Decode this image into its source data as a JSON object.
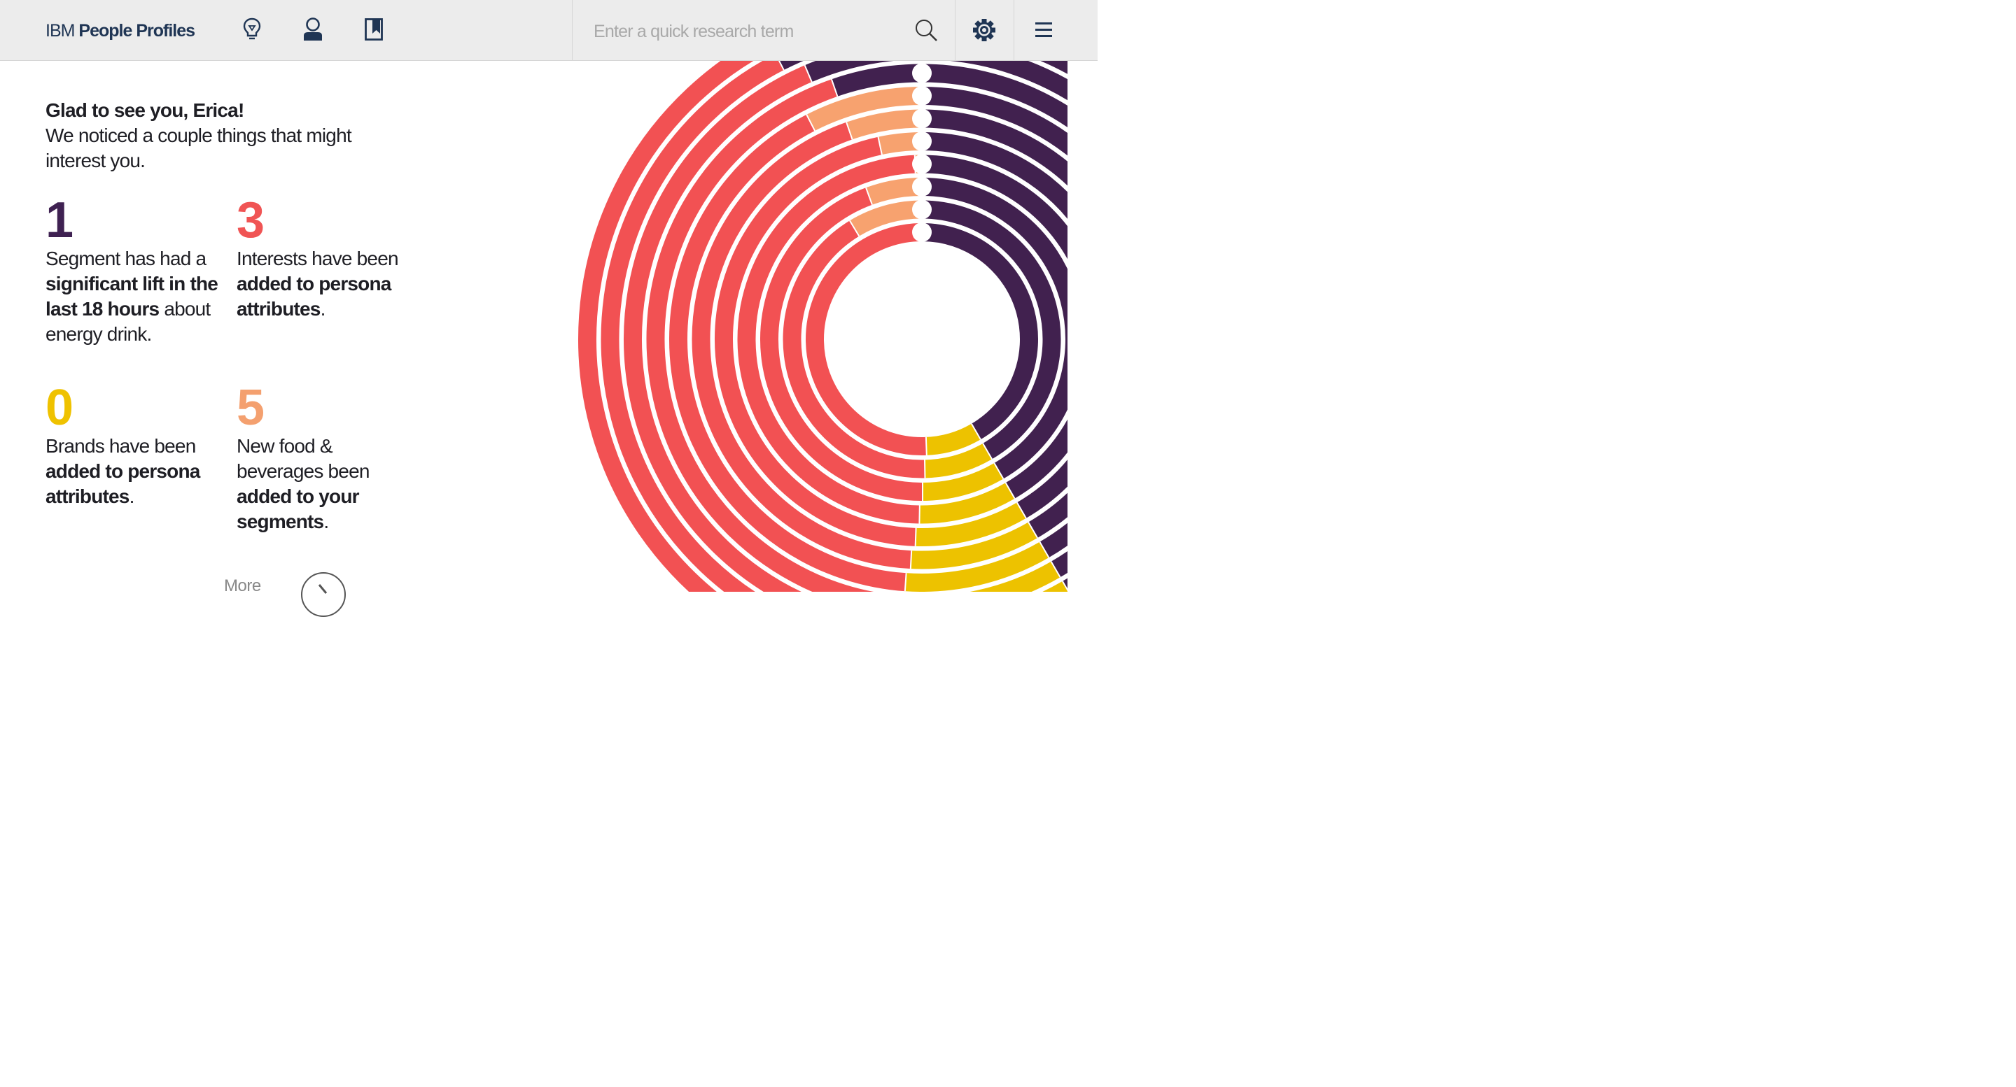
{
  "header": {
    "brand_light": "IBM",
    "brand_bold": "People Profiles",
    "nav_icons": [
      "lightbulb-icon",
      "person-icon",
      "bookmark-icon"
    ],
    "search_placeholder": "Enter a quick research term",
    "search_icon": "search-icon",
    "settings_icon": "gear-icon",
    "menu_icon": "hamburger-menu-icon"
  },
  "greeting": {
    "hello": "Glad to see you, Erica!",
    "subtitle": "We noticed a couple things that might interest you."
  },
  "stats": [
    {
      "number": "1",
      "color": "#3f2152",
      "pre": "Segment has had a ",
      "bold": "significant lift in the last 18 hours",
      "post": " about energy drink."
    },
    {
      "number": "3",
      "color": "#f05454",
      "pre": "Interests have been ",
      "bold": "added to persona attributes",
      "post": "."
    },
    {
      "number": "0",
      "color": "#efc200",
      "pre": "Brands have been ",
      "bold": "added to persona attributes",
      "post": "."
    },
    {
      "number": "5",
      "color": "#f4a06f",
      "pre": "New food & beverages been ",
      "bold": "added to your segments",
      "post": "."
    }
  ],
  "more_label": "More",
  "colors": {
    "purple": "#41214f",
    "red": "#f25153",
    "orange": "#f7a26f",
    "yellow": "#edc200",
    "topbar": "#ececec",
    "brand": "#1f3554"
  },
  "chart_data": {
    "type": "radial-bar",
    "rings": [
      {
        "segments": [
          {
            "color": "purple",
            "deg": 150
          },
          {
            "color": "yellow",
            "deg": 28
          },
          {
            "color": "red",
            "deg": 182
          }
        ]
      },
      {
        "segments": [
          {
            "color": "purple",
            "deg": 150
          },
          {
            "color": "yellow",
            "deg": 29
          },
          {
            "color": "red",
            "deg": 150
          },
          {
            "color": "orange",
            "deg": 31
          }
        ]
      },
      {
        "segments": [
          {
            "color": "purple",
            "deg": 150
          },
          {
            "color": "yellow",
            "deg": 30
          },
          {
            "color": "red",
            "deg": 160
          },
          {
            "color": "orange",
            "deg": 20
          }
        ]
      },
      {
        "segments": [
          {
            "color": "purple",
            "deg": 150
          },
          {
            "color": "yellow",
            "deg": 31
          },
          {
            "color": "red",
            "deg": 177
          },
          {
            "color": "orange",
            "deg": 2
          }
        ]
      },
      {
        "segments": [
          {
            "color": "purple",
            "deg": 150
          },
          {
            "color": "yellow",
            "deg": 32
          },
          {
            "color": "red",
            "deg": 166
          },
          {
            "color": "orange",
            "deg": 12
          }
        ]
      },
      {
        "segments": [
          {
            "color": "purple",
            "deg": 150
          },
          {
            "color": "yellow",
            "deg": 33
          },
          {
            "color": "red",
            "deg": 158
          },
          {
            "color": "orange",
            "deg": 19
          }
        ]
      },
      {
        "segments": [
          {
            "color": "purple",
            "deg": 150
          },
          {
            "color": "yellow",
            "deg": 34
          },
          {
            "color": "red",
            "deg": 149
          },
          {
            "color": "orange",
            "deg": 27
          }
        ]
      },
      {
        "segments": [
          {
            "color": "purple",
            "deg": 150
          },
          {
            "color": "yellow",
            "deg": 35
          },
          {
            "color": "red",
            "deg": 156
          },
          {
            "color": "purple",
            "deg": 19
          }
        ]
      },
      {
        "segments": [
          {
            "color": "purple",
            "deg": 150
          },
          {
            "color": "yellow",
            "deg": 36
          },
          {
            "color": "red",
            "deg": 151
          },
          {
            "color": "purple",
            "deg": 23
          }
        ]
      },
      {
        "segments": [
          {
            "color": "purple",
            "deg": 150
          },
          {
            "color": "yellow",
            "deg": 37
          },
          {
            "color": "red",
            "deg": 146
          },
          {
            "color": "purple",
            "deg": 27
          }
        ]
      },
      {
        "segments": [
          {
            "color": "purple",
            "deg": 150
          },
          {
            "color": "yellow",
            "deg": 38
          },
          {
            "color": "red",
            "deg": 172
          }
        ]
      }
    ]
  }
}
